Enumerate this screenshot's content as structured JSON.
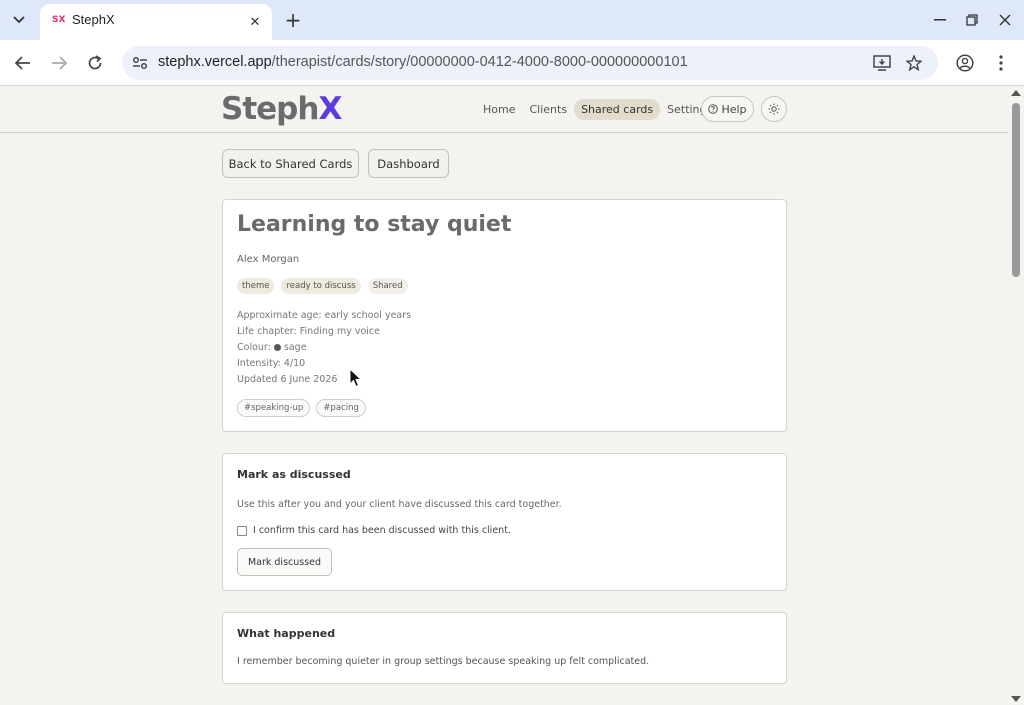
{
  "browser": {
    "tab_title": "StephX",
    "favicon_text": "SX",
    "url_host": "stephx.vercel.app",
    "url_path": "/therapist/cards/story/00000000-0412-4000-8000-000000000101"
  },
  "header": {
    "logo_main": "Steph",
    "logo_x": "X",
    "nav": [
      {
        "label": "Home"
      },
      {
        "label": "Clients"
      },
      {
        "label": "Shared cards"
      },
      {
        "label": "Settings"
      }
    ],
    "help_label": "Help"
  },
  "actions": {
    "back_label": "Back to Shared Cards",
    "dashboard_label": "Dashboard"
  },
  "story": {
    "title": "Learning to stay quiet",
    "author": "Alex Morgan",
    "chips": [
      "theme",
      "ready to discuss",
      "Shared"
    ],
    "approx_age": "Approximate age: early school years",
    "life_chapter": "Life chapter: Finding my voice",
    "colour_label": "Colour:",
    "colour_value": "sage",
    "intensity": "Intensity: 4/10",
    "updated": "Updated 6 June 2026",
    "tags": [
      "#speaking-up",
      "#pacing"
    ]
  },
  "discussed": {
    "title": "Mark as discussed",
    "description": "Use this after you and your client have discussed this card together.",
    "confirm_label": "I confirm this card has been discussed with this client.",
    "button_label": "Mark discussed"
  },
  "what_happened": {
    "title": "What happened",
    "text": "I remember becoming quieter in group settings because speaking up felt complicated."
  },
  "colors": {
    "accent": "#5b3ce0",
    "active_nav": "#e2dccd",
    "page_bg": "#f4f3f0"
  }
}
